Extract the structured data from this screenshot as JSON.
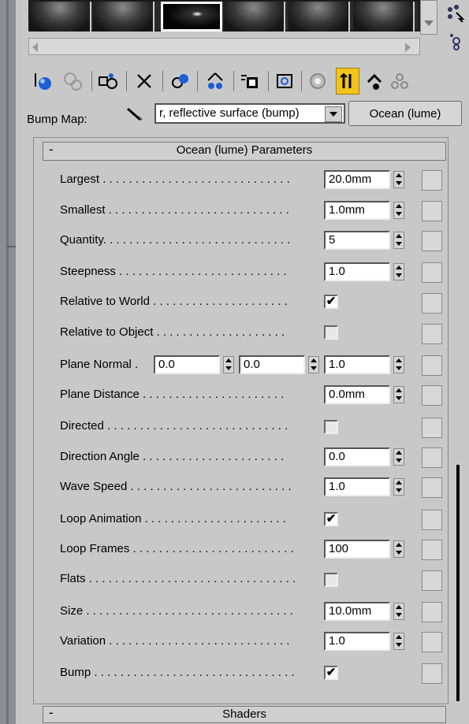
{
  "toolbar": {
    "icons": [
      "get-material-icon",
      "put-to-scene-icon",
      "assign-to-selection-icon",
      "reset-map-icon",
      "make-unique-icon",
      "put-to-library-icon",
      "material-id-icon",
      "show-map-icon",
      "show-end-result-icon",
      "go-to-parent-icon",
      "go-forward-icon"
    ]
  },
  "bump": {
    "label": "Bump Map:",
    "map_name": "r, reflective surface (bump)",
    "map_type": "Ocean (lume)"
  },
  "rollout": {
    "minus": "-",
    "title": "Ocean (lume) Parameters"
  },
  "params": {
    "largest": {
      "label": "Largest . . . . . . . . . . . . . . . . . . . . . . . . . . . . .",
      "value": "20.0mm"
    },
    "smallest": {
      "label": "Smallest . . . . . . . . . . . . . . . . . . . . . . . . . . . .",
      "value": "1.0mm"
    },
    "quantity": {
      "label": "Quantity. . . . . . . . . . . . . . . . . . . . . . . . . . . . .",
      "value": "5"
    },
    "steepness": {
      "label": "Steepness . . . . . . . . . . . . . . . . . . . . . . . . . .",
      "value": "1.0"
    },
    "relative_world": {
      "label": "Relative to World . . . . . . . . . . . . . . . . . . . . .",
      "checked": true
    },
    "relative_object": {
      "label": "Relative to Object . . . . . . . . . . . . . . . . . . . .",
      "checked": false
    },
    "plane_normal": {
      "label": "Plane Normal .",
      "x": "0.0",
      "y": "0.0",
      "z": "1.0"
    },
    "plane_distance": {
      "label": "Plane Distance . . . . . . . . . . . . . . . . . . . . . .",
      "value": "0.0mm"
    },
    "directed": {
      "label": "Directed . . . . . . . . . . . . . . . . . . . . . . . . . . . .",
      "checked": false
    },
    "direction_angle": {
      "label": "Direction Angle . . . . . . . . . . . . . . . . . . . . . .",
      "value": "0.0"
    },
    "wave_speed": {
      "label": "Wave Speed . . . . . . . . . . . . . . . . . . . . . . . . .",
      "value": "1.0"
    },
    "loop_animation": {
      "label": "Loop Animation . . . . . . . . . . . . . . . . . . . . . .",
      "checked": true
    },
    "loop_frames": {
      "label": "Loop Frames . . . . . . . . . . . . . . . . . . . . . . . . .",
      "value": "100"
    },
    "flats": {
      "label": "Flats . . . . . . . . . . . . . . . . . . . . . . . . . . . . . . . .",
      "checked": false
    },
    "size": {
      "label": "Size . . . . . . . . . . . . . . . . . . . . . . . . . . . . . . . .",
      "value": "10.0mm"
    },
    "variation": {
      "label": "Variation . . . . . . . . . . . . . . . . . . . . . . . . . . . .",
      "value": "1.0"
    },
    "bump": {
      "label": "Bump . . . . . . . . . . . . . . . . . . . . . . . . . . . . . . .",
      "checked": true
    }
  },
  "shaders": {
    "minus": "-",
    "title": "Shaders"
  },
  "check_glyph": "✔"
}
